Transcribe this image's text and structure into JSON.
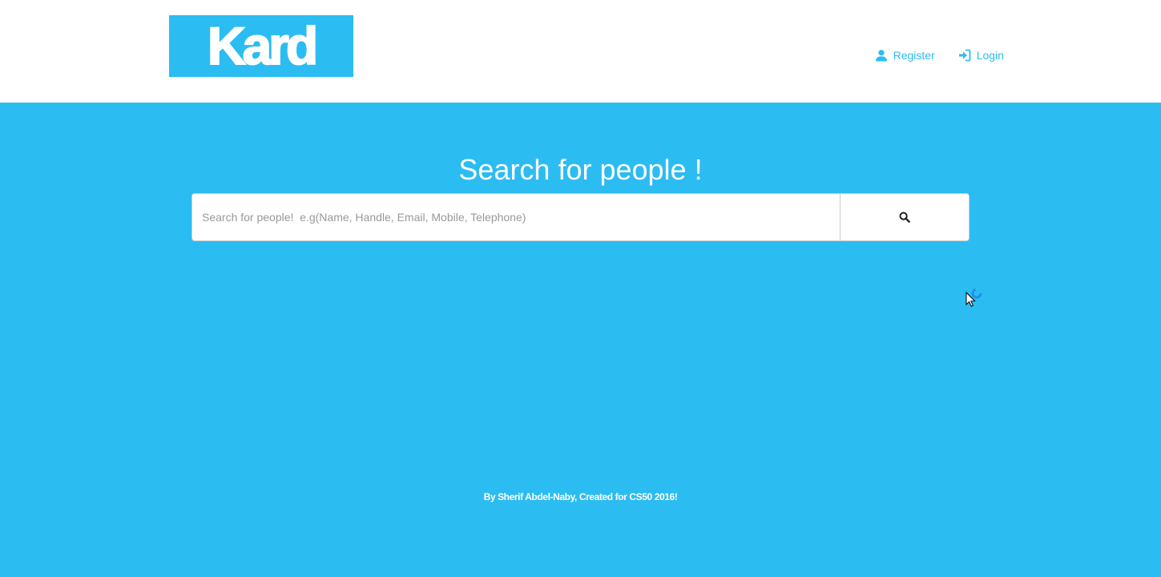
{
  "header": {
    "logo_text": "Kard",
    "nav": [
      {
        "label": "Register",
        "icon": "user-icon"
      },
      {
        "label": "Login",
        "icon": "login-icon"
      }
    ]
  },
  "main": {
    "title": "Search for people !",
    "search": {
      "placeholder": "Search for people!  e.g(Name, Handle, Email, Mobile, Telephone)",
      "value": "",
      "button_icon": "search-icon"
    }
  },
  "footer": {
    "text": "By Sherif Abdel-Naby, Created for CS50 2016!"
  },
  "colors": {
    "brand": "#2bbcf2",
    "background": "#2bbcf2",
    "header_background": "#ffffff",
    "text_on_brand": "#ffffff"
  }
}
